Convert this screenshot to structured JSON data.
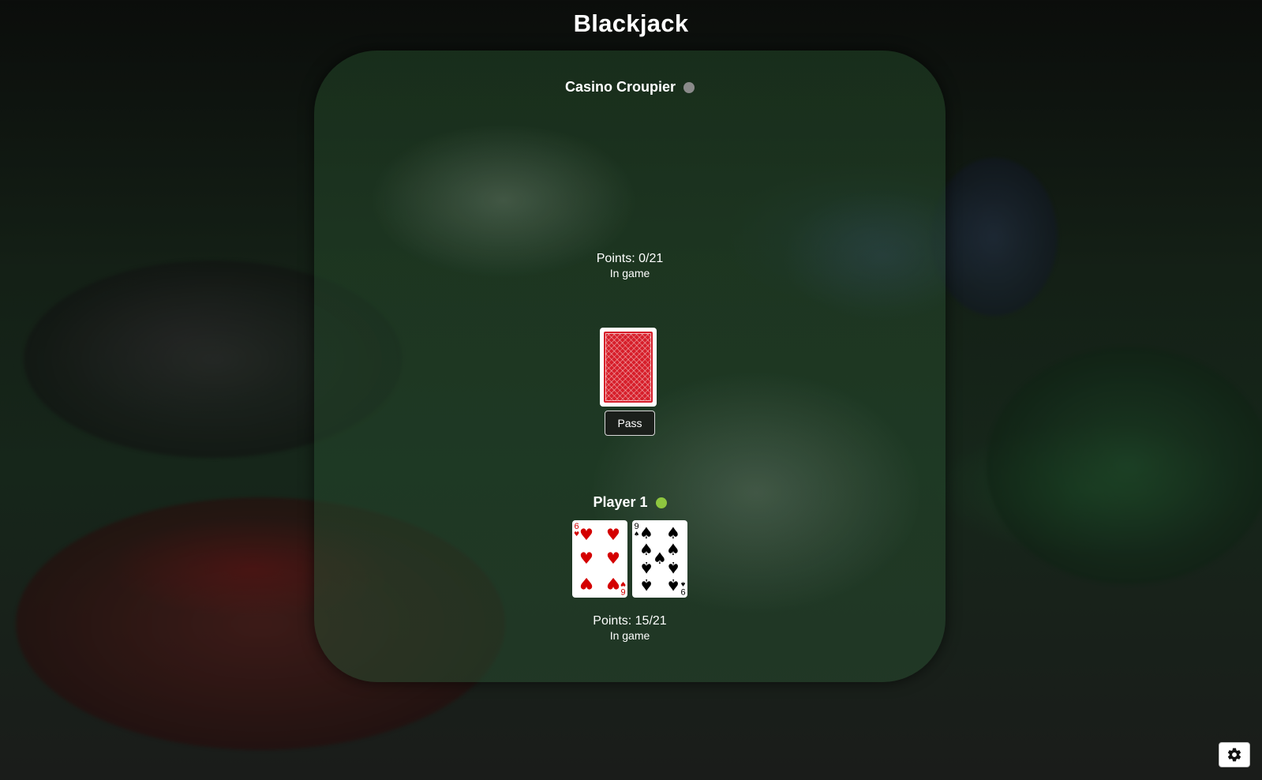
{
  "title": "Blackjack",
  "dealer": {
    "name": "Casino Croupier",
    "status_color": "#8a8a8a",
    "points": "Points: 0/21",
    "state": "In game"
  },
  "deck": {
    "icon": "card-back"
  },
  "controls": {
    "pass_label": "Pass"
  },
  "player": {
    "name": "Player 1",
    "status_color": "#8ec63f",
    "points": "Points: 15/21",
    "state": "In game",
    "cards": [
      {
        "rank": "6",
        "suit": "♥",
        "color": "red"
      },
      {
        "rank": "9",
        "suit": "♠",
        "color": "black"
      }
    ]
  },
  "settings": {
    "icon": "gear-icon"
  }
}
